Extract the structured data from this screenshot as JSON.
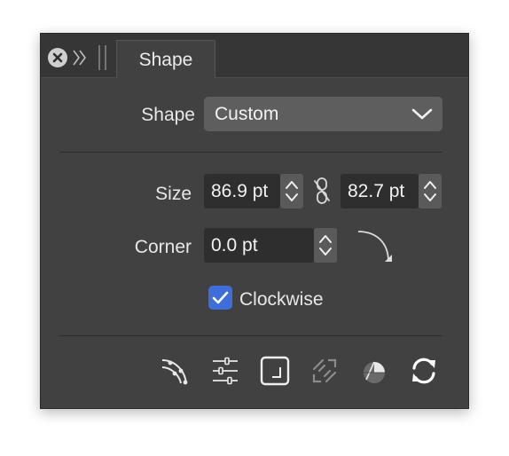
{
  "panel": {
    "tab_label": "Shape"
  },
  "shape": {
    "label": "Shape",
    "selected": "Custom"
  },
  "size": {
    "label": "Size",
    "width": "86.9 pt",
    "height": "82.7 pt"
  },
  "corner": {
    "label": "Corner",
    "value": "0.0 pt"
  },
  "clockwise": {
    "label": "Clockwise",
    "checked": true
  },
  "icons": {
    "close": "close-icon",
    "collapse": "double-chevron-right-icon",
    "grip": "drag-grip-icon",
    "dropdown": "chevron-down-icon",
    "link": "chain-link-icon",
    "corner": "corner-curve-icon",
    "toolbar": [
      "path-nodes-icon",
      "sliders-icon",
      "rounded-rectangle-icon",
      "break-curves-icon",
      "pie-shape-icon",
      "refresh-icon"
    ]
  },
  "colors": {
    "panel_bg": "#414141",
    "titlebar_bg": "#363636",
    "field_bg": "#2e2e2e",
    "accent": "#3e6fd8"
  }
}
